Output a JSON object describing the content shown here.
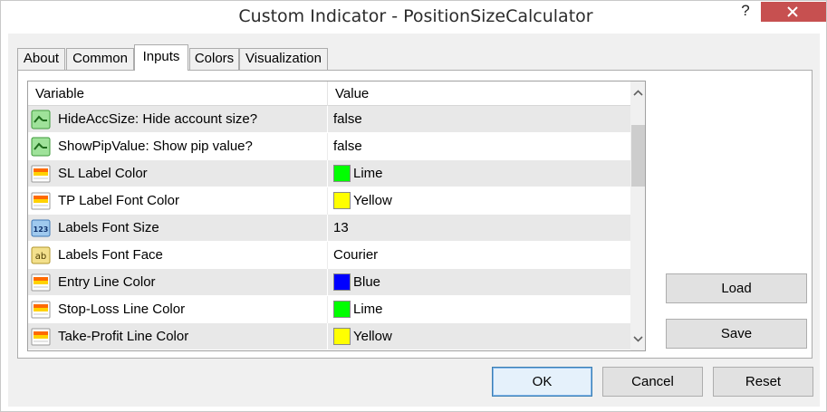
{
  "window": {
    "title": "Custom Indicator - PositionSizeCalculator",
    "help_label": "?"
  },
  "tabs": [
    {
      "label": "About"
    },
    {
      "label": "Common"
    },
    {
      "label": "Inputs"
    },
    {
      "label": "Colors"
    },
    {
      "label": "Visualization"
    }
  ],
  "active_tab": "Inputs",
  "grid": {
    "col_variable": "Variable",
    "col_value": "Value",
    "rows": [
      {
        "icon": "boolean-icon",
        "name": "HideAccSize: Hide account size?",
        "value": "false"
      },
      {
        "icon": "boolean-icon",
        "name": "ShowPipValue: Show pip value?",
        "value": "false"
      },
      {
        "icon": "color-icon",
        "name": "SL Label  Color",
        "value": "Lime",
        "swatch": "#00ff00"
      },
      {
        "icon": "color-icon",
        "name": "TP Label Font Color",
        "value": "Yellow",
        "swatch": "#ffff00"
      },
      {
        "icon": "integer-icon",
        "name": "Labels Font Size",
        "value": "13"
      },
      {
        "icon": "string-icon",
        "name": "Labels Font Face",
        "value": "Courier"
      },
      {
        "icon": "color-icon",
        "name": "Entry Line Color",
        "value": "Blue",
        "swatch": "#0000ff"
      },
      {
        "icon": "color-icon",
        "name": "Stop-Loss Line Color",
        "value": "Lime",
        "swatch": "#00ff00"
      },
      {
        "icon": "color-icon",
        "name": "Take-Profit Line Color",
        "value": "Yellow",
        "swatch": "#ffff00"
      }
    ]
  },
  "buttons": {
    "load": "Load",
    "save": "Save",
    "ok": "OK",
    "cancel": "Cancel",
    "reset": "Reset"
  },
  "colors": {
    "close_button": "#c75050",
    "selected_row": "#e8e8e8",
    "default_button_border": "#3c7fb1"
  }
}
